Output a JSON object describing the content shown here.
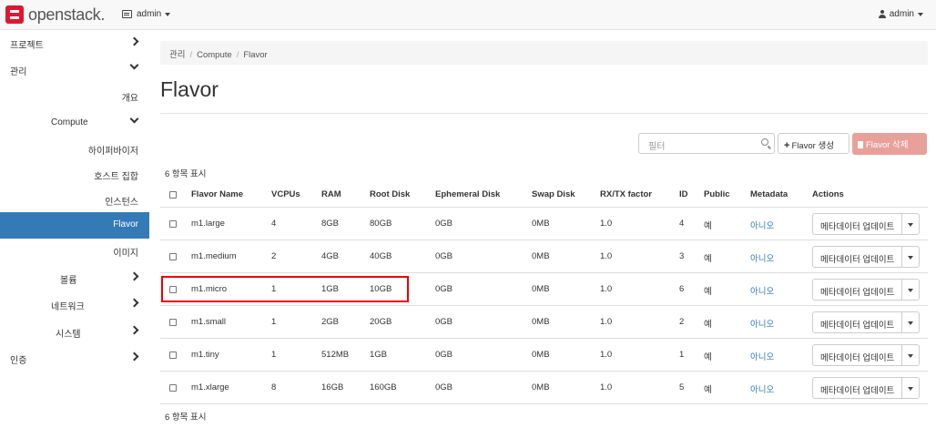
{
  "navbar": {
    "brand": "openstack.",
    "project": "admin",
    "user": "admin"
  },
  "sidebar": {
    "items": [
      {
        "label": "프로젝트"
      },
      {
        "label": "관리"
      },
      {
        "label": "개요"
      },
      {
        "label": "Compute"
      },
      {
        "label": "하이퍼바이저"
      },
      {
        "label": "호스트 집합"
      },
      {
        "label": "인스턴스"
      },
      {
        "label": "Flavor"
      },
      {
        "label": "이미지"
      },
      {
        "label": "볼륨"
      },
      {
        "label": "네트워크"
      },
      {
        "label": "시스템"
      },
      {
        "label": "인증"
      }
    ]
  },
  "breadcrumb": [
    "관리",
    "Compute",
    "Flavor"
  ],
  "page_title": "Flavor",
  "toolbar": {
    "filter_placeholder": "필터",
    "create_label": "Flavor 생성",
    "delete_label": "Flavor 삭제"
  },
  "count_label": "6 항목 표시",
  "table": {
    "headers": [
      "Flavor Name",
      "VCPUs",
      "RAM",
      "Root Disk",
      "Ephemeral Disk",
      "Swap Disk",
      "RX/TX factor",
      "ID",
      "Public",
      "Metadata",
      "Actions"
    ],
    "rows": [
      [
        "m1.large",
        "4",
        "8GB",
        "80GB",
        "0GB",
        "0MB",
        "1.0",
        "4",
        "예",
        "아니오"
      ],
      [
        "m1.medium",
        "2",
        "4GB",
        "40GB",
        "0GB",
        "0MB",
        "1.0",
        "3",
        "예",
        "아니오"
      ],
      [
        "m1.micro",
        "1",
        "1GB",
        "10GB",
        "0GB",
        "0MB",
        "1.0",
        "6",
        "예",
        "아니오"
      ],
      [
        "m1.small",
        "1",
        "2GB",
        "20GB",
        "0GB",
        "0MB",
        "1.0",
        "2",
        "예",
        "아니오"
      ],
      [
        "m1.tiny",
        "1",
        "512MB",
        "1GB",
        "0GB",
        "0MB",
        "1.0",
        "1",
        "예",
        "아니오"
      ],
      [
        "m1.xlarge",
        "8",
        "16GB",
        "160GB",
        "0GB",
        "0MB",
        "1.0",
        "5",
        "예",
        "아니오"
      ]
    ],
    "action_label": "메타데이터 업데이트"
  },
  "colors": {
    "active": "#337ab7",
    "link": "#337ab7",
    "danger_disabled": "#e8a09a",
    "highlight": "#ee0000"
  }
}
